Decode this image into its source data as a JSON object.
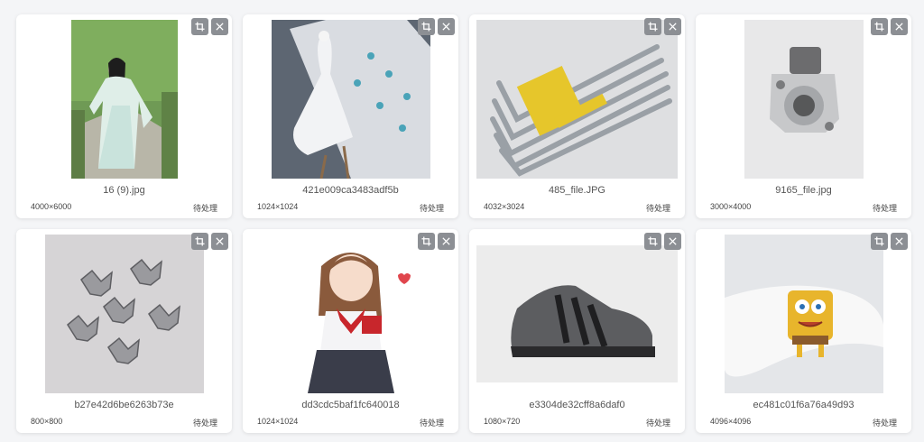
{
  "cards": [
    {
      "filename": "16 (9).jpg",
      "dimensions": "4000×6000",
      "status": "待处理",
      "image": "woman-hanfu-photo"
    },
    {
      "filename": "421e009ca3483adf5b",
      "dimensions": "1024×1024",
      "status": "待处理",
      "image": "white-peacock-illustration"
    },
    {
      "filename": "485_file.JPG",
      "dimensions": "4032×3024",
      "status": "待处理",
      "image": "hex-key-set-photo"
    },
    {
      "filename": "9165_file.jpg",
      "dimensions": "3000×4000",
      "status": "待处理",
      "image": "starter-motor-photo"
    },
    {
      "filename": "b27e42d6be6263b73e",
      "dimensions": "800×800",
      "status": "待处理",
      "image": "silver-bow-charms-photo"
    },
    {
      "filename": "dd3cdc5baf1fc640018",
      "dimensions": "1024×1024",
      "status": "待处理",
      "image": "anime-girl-gift-illustration"
    },
    {
      "filename": "e3304de32cff8a6daf0",
      "dimensions": "1080×720",
      "status": "待处理",
      "image": "grey-sneaker-photo"
    },
    {
      "filename": "ec481c01f6a76a49d93",
      "dimensions": "4096×4096",
      "status": "待处理",
      "image": "spongebob-shoe-charm-photo"
    }
  ],
  "icons": {
    "crop": "crop-icon",
    "close": "close-icon"
  },
  "colors": {
    "background": "#f4f5f7",
    "card": "#ffffff",
    "action_button": "#8c8f94"
  }
}
